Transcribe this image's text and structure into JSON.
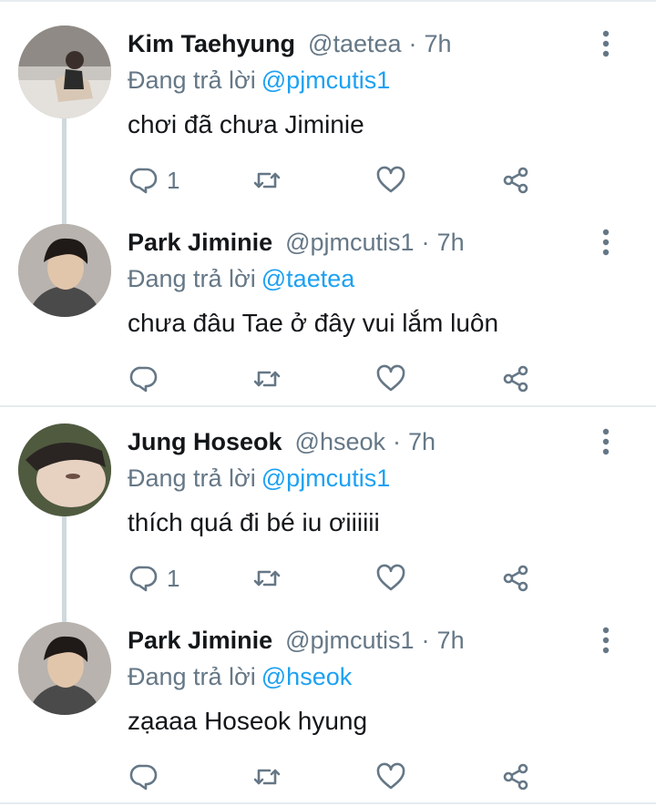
{
  "tweets": [
    {
      "name": "Kim Taehyung",
      "handle": "@taetea",
      "dot": "·",
      "time": "7h",
      "replying_prefix": "Đang trả lời",
      "replying_to": "@pjmcutis1",
      "text": "chơi đã chưa Jiminie",
      "reply_count": "1",
      "avatar_icon": "person-photo-avatar"
    },
    {
      "name": "Park Jiminie",
      "handle": "@pjmcutis1",
      "dot": "·",
      "time": "7h",
      "replying_prefix": "Đang trả lời",
      "replying_to": "@taetea",
      "text": "chưa đâu Tae ở đây vui lắm luôn",
      "reply_count": "",
      "avatar_icon": "person-photo-avatar"
    },
    {
      "name": "Jung Hoseok",
      "handle": "@hseok",
      "dot": "·",
      "time": "7h",
      "replying_prefix": "Đang trả lời",
      "replying_to": "@pjmcutis1",
      "text": "thích quá đi bé iu ơiiiiii",
      "reply_count": "1",
      "avatar_icon": "person-photo-avatar"
    },
    {
      "name": "Park Jiminie",
      "handle": "@pjmcutis1",
      "dot": "·",
      "time": "7h",
      "replying_prefix": "Đang trả lời",
      "replying_to": "@hseok",
      "text": "zạaaa Hoseok hyung",
      "reply_count": "",
      "avatar_icon": "person-photo-avatar"
    }
  ],
  "icons": {
    "reply": "reply-icon",
    "retweet": "retweet-icon",
    "like": "heart-icon",
    "share": "share-icon",
    "more": "more-vertical-icon"
  },
  "colors": {
    "text": "#14171a",
    "secondary": "#657786",
    "link": "#1da1f2",
    "divider": "#e6ecf0",
    "thread_line": "#cfd9de"
  }
}
